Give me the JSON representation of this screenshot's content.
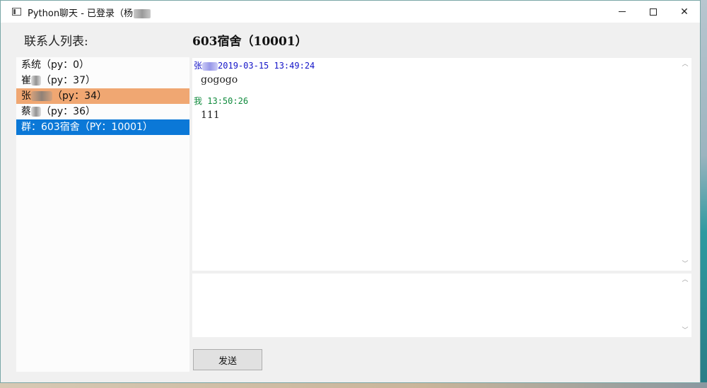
{
  "window": {
    "title": "Python聊天 - 已登录（杨",
    "minimize_label": "",
    "maximize_label": "",
    "close_label": "✕"
  },
  "sidebar": {
    "heading": "联系人列表:",
    "contacts": [
      {
        "name": "系统",
        "suffix": "（py：0）",
        "state": "normal"
      },
      {
        "name": "崔",
        "suffix": "（py：37）",
        "state": "normal"
      },
      {
        "name": "张",
        "suffix": "（py：34）",
        "state": "hover"
      },
      {
        "name": "蔡",
        "suffix": "（py：36）",
        "state": "normal"
      },
      {
        "name": "群：603宿舍",
        "suffix": "（PY：10001）",
        "state": "selected"
      }
    ]
  },
  "chat": {
    "room_title": "603宿舍（10001）",
    "messages": [
      {
        "sender": "张",
        "time": "2019-03-15 13:49:24",
        "text": "gogogo",
        "from_me": false
      },
      {
        "sender": "我",
        "time": "13:50:26",
        "text": "111",
        "from_me": true
      }
    ]
  },
  "compose": {
    "value": "",
    "send_label": "发送"
  },
  "colors": {
    "hover_row": "#f0a772",
    "selected_row": "#0b78d7",
    "other_sender": "#1515c8",
    "me_sender": "#0f8a3c"
  }
}
